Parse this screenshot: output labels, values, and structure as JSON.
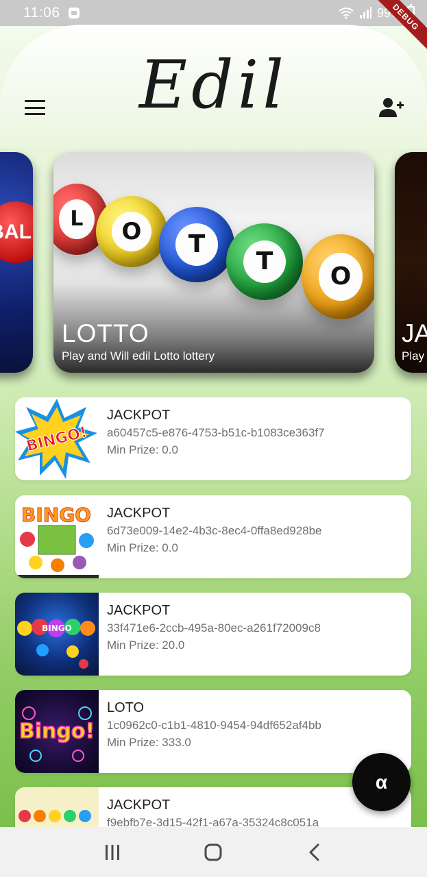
{
  "status_bar": {
    "time": "11:06",
    "battery": "99%",
    "debug_label": "DEBUG",
    "icons": [
      "wifi-icon",
      "signal-icon",
      "battery-icon"
    ]
  },
  "header": {
    "logo_text": "Edil",
    "menu_icon": "menu-icon",
    "add_user_icon": "add-user-icon"
  },
  "carousel": {
    "left_card": {
      "partial_text": "BAL"
    },
    "main_card": {
      "title": "LOTTO",
      "subtitle": "Play and Will edil Lotto lottery",
      "ball_letters": [
        "L",
        "O",
        "T",
        "T",
        "O"
      ],
      "ball_colors": [
        "#e53935",
        "#f4d21f",
        "#1e55d6",
        "#1ea23a",
        "#f2a313"
      ]
    },
    "right_card": {
      "title": "JA",
      "subtitle": "Play"
    }
  },
  "list": [
    {
      "title": "JACKPOT",
      "id": "a60457c5-e876-4753-b51c-b1083ce363f7",
      "prize": "Min Prize: 0.0",
      "thumb_text": "BINGO!"
    },
    {
      "title": "JACKPOT",
      "id": "6d73e009-14e2-4b3c-8ec4-0ffa8ed928be",
      "prize": "Min Prize: 0.0",
      "thumb_text": "BINGO"
    },
    {
      "title": "JACKPOT",
      "id": "33f471e6-2ccb-495a-80ec-a261f72009c8",
      "prize": "Min Prize: 20.0",
      "thumb_text": "BINGO"
    },
    {
      "title": "LOTO",
      "id": "1c0962c0-c1b1-4810-9454-94df652af4bb",
      "prize": "Min Prize: 333.0",
      "thumb_text": "Bingo!"
    },
    {
      "title": "JACKPOT",
      "id": "f9ebfb7e-3d15-42f1-a67a-35324c8c051a",
      "prize": "",
      "thumb_text": ""
    }
  ],
  "fab": {
    "label": "α"
  },
  "nav_bar": {
    "icons": [
      "recents-icon",
      "home-icon",
      "back-icon"
    ]
  }
}
